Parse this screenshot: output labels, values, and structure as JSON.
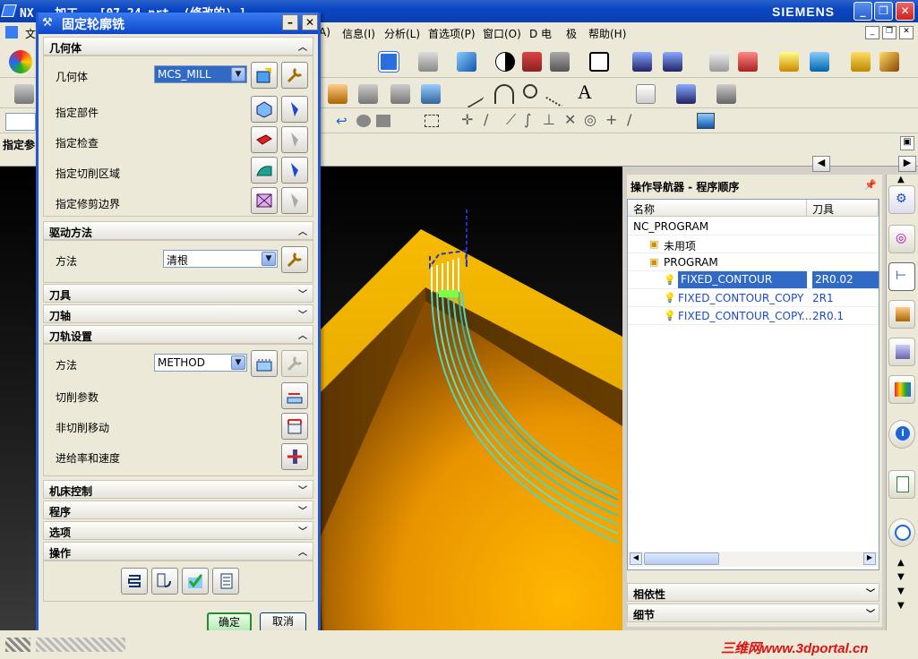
{
  "window": {
    "title": "NX - 加工 - [07-24.prt  (修改的) ]",
    "brand": "SIEMENS"
  },
  "menubar": {
    "items": [
      "文",
      "A)",
      "信息(I)",
      "分析(L)",
      "首选项(P)",
      "窗口(O)",
      "D 电",
      "极",
      "帮助(H)"
    ],
    "left_label": "指定参"
  },
  "dialog": {
    "title": "固定轮廓铣",
    "sections": {
      "geometry": "几何体",
      "drive": "驱动方法",
      "tool": "刀具",
      "axis": "刀轴",
      "path": "刀轨设置",
      "machine": "机床控制",
      "program": "程序",
      "options": "选项",
      "operations": "操作"
    },
    "geometry": {
      "label": "几何体",
      "value": "MCS_MILL",
      "part": "指定部件",
      "check": "指定检查",
      "cut_area": "指定切削区域",
      "trim": "指定修剪边界"
    },
    "drive": {
      "label": "方法",
      "value": "清根"
    },
    "path": {
      "method_label": "方法",
      "method_value": "METHOD",
      "cut_params": "切削参数",
      "non_cut": "非切削移动",
      "feeds": "进给率和速度"
    },
    "buttons": {
      "ok": "确定",
      "cancel": "取消"
    }
  },
  "navigator": {
    "title": "操作导航器 - 程序顺序",
    "columns": [
      "名称",
      "刀具"
    ],
    "rows": [
      {
        "name": "NC_PROGRAM",
        "tool": "",
        "indent": 0,
        "selected": false
      },
      {
        "name": "未用项",
        "tool": "",
        "indent": 1,
        "selected": false
      },
      {
        "name": "PROGRAM",
        "tool": "",
        "indent": 1,
        "selected": false
      },
      {
        "name": "FIXED_CONTOUR",
        "tool": "2R0.02",
        "indent": 2,
        "selected": true
      },
      {
        "name": "FIXED_CONTOUR_COPY",
        "tool": "2R1",
        "indent": 2,
        "selected": false
      },
      {
        "name": "FIXED_CONTOUR_COPY...",
        "tool": "2R0.1",
        "indent": 2,
        "selected": false
      }
    ],
    "sections": {
      "dependencies": "相依性",
      "details": "细节"
    }
  },
  "watermark": "三维网www.3dportal.cn",
  "colors": {
    "accent": "#316ac5",
    "part": "#f5b800",
    "toolpath": "#4fd7c0"
  }
}
